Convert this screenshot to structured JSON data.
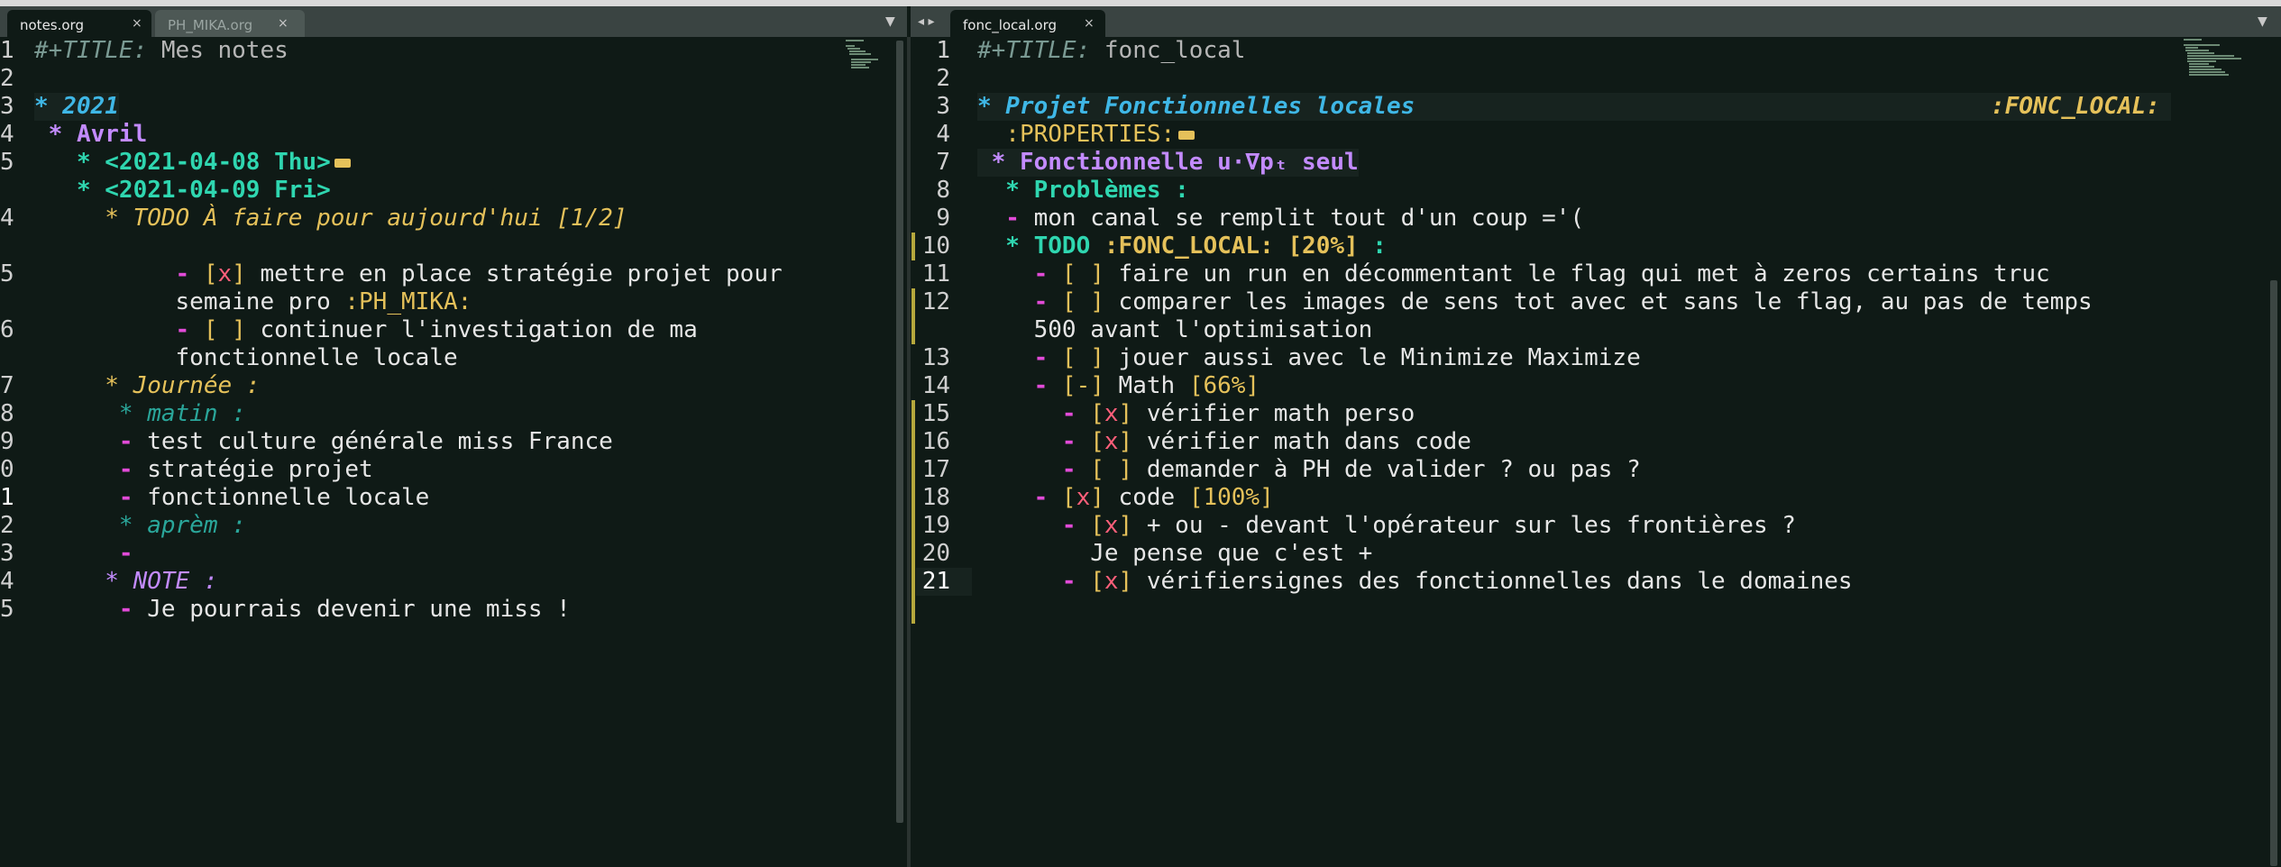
{
  "left_tabs": [
    {
      "label": "notes.org",
      "active": true
    },
    {
      "label": "PH_MIKA.org",
      "active": false
    }
  ],
  "right_tabs": [
    {
      "label": "fonc_local.org",
      "active": true
    }
  ],
  "close_glyph": "×",
  "menu_glyph": "▼",
  "nav_glyph": "◂ ▸",
  "left_editor": {
    "line_numbers": [
      "1",
      "2",
      "3",
      "4",
      "5",
      "4",
      "5",
      "6",
      "7",
      "8",
      "9",
      "0",
      "1",
      "2",
      "3",
      "4",
      "5"
    ],
    "lines": {
      "l1a": "#+TITLE:",
      "l1b": " Mes notes",
      "l3": "* 2021",
      "l4": " * Avril",
      "l5": "   * <2021-04-08 Thu>",
      "l6": "   * <2021-04-09 Fri>",
      "l7a": "     * TODO À faire pour aujourd'hui",
      "l7b": " [1/2]",
      "l9a": "          - ",
      "l9b": "[",
      "l9c": "x",
      "l9d": "]",
      "l9e": " mettre en place stratégie projet pour",
      "l10a": "          semaine pro ",
      "l10b": ":PH_MIKA:",
      "l11a": "          - ",
      "l11b": "[ ]",
      "l11c": " continuer l'investigation de ma",
      "l12": "          fonctionnelle locale",
      "l13": "     * Journée :",
      "l14": "      * matin :",
      "l15a": "      - ",
      "l15b": "test culture générale miss France",
      "l16a": "      - ",
      "l16b": "stratégie projet",
      "l17a": "      - ",
      "l17b": "fonctionnelle locale",
      "l18": "      * aprèm :",
      "l19": "      -",
      "l20": "     * NOTE :",
      "l21a": "      - ",
      "l21b": "Je pourrais devenir une miss !"
    }
  },
  "right_editor": {
    "line_numbers": [
      "1",
      "2",
      "3",
      "4",
      "7",
      "8",
      "9",
      "10",
      "11",
      "12",
      "",
      "13",
      "14",
      "15",
      "16",
      "17",
      "18",
      "19",
      "20",
      "21"
    ],
    "lines": {
      "r1a": "#+TITLE:",
      "r1b": " fonc_local",
      "r3a": "* Projet Fonctionnelles locales",
      "r3b": ":FONC_LOCAL:",
      "r4": "  :PROPERTIES:",
      "r7": " * Fonctionnelle u·∇pₜ seul",
      "r8": "  * Problèmes :",
      "r9a": "  - ",
      "r9b": "mon canal se remplit tout d'un coup ='(",
      "r10a": "  * TODO ",
      "r10b": ":FONC_LOCAL: [20%]",
      "r10c": " :",
      "r11a": "    - ",
      "r11b": "[ ]",
      "r11c": " faire un run en décommentant le flag qui met à zeros certains truc",
      "r12a": "    - ",
      "r12b": "[ ]",
      "r12c": " comparer les images de sens tot avec et sans le flag, au pas de temps",
      "r12d": "    500 avant l'optimisation",
      "r13a": "    - ",
      "r13b": "[ ]",
      "r13c": " jouer aussi avec le Minimize Maximize",
      "r14a": "    - ",
      "r14b": "[-]",
      "r14c": " Math ",
      "r14d": "[66%]",
      "r15a": "      - ",
      "r15b": "[",
      "r15c": "x",
      "r15d": "]",
      "r15e": " vérifier math perso",
      "r16a": "      - ",
      "r16b": "[",
      "r16c": "x",
      "r16d": "]",
      "r16e": " vérifier math dans code",
      "r17a": "      - ",
      "r17b": "[ ]",
      "r17c": " demander à PH de valider ? ou pas ?",
      "r18a": "    - ",
      "r18b": "[",
      "r18c": "x",
      "r18d": "]",
      "r18e": " code ",
      "r18f": "[100%]",
      "r19a": "      - ",
      "r19b": "[",
      "r19c": "x",
      "r19d": "]",
      "r19e": " + ou - devant l'opérateur sur les frontières ?",
      "r20": "        Je pense que c'est +",
      "r21a": "      - ",
      "r21b": "[",
      "r21c": "x",
      "r21d": "]",
      "r21e": " vérifiersignes des fonctionnelles dans le domaines"
    }
  },
  "colors": {
    "background": "#0f1a16",
    "heading1": "#3fb7e6",
    "heading2": "#c38bff",
    "heading3": "#2fd6b0",
    "todo": "#e5c15a",
    "checkbox_x": "#ff5f7a",
    "bullet": "#e24bd8"
  }
}
